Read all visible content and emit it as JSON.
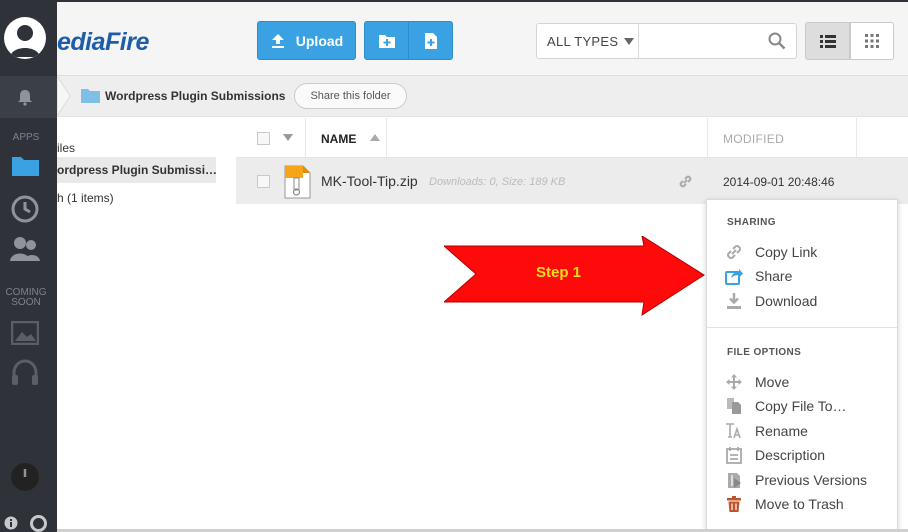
{
  "app": {
    "logo_text": "ediaFire",
    "accent": "#3aa2e2",
    "rail_bg": "#2f3339"
  },
  "rail": {
    "apps_label": "APPS",
    "coming_soon_label": "COMING SOON",
    "icons": [
      "avatar",
      "bell-icon",
      "folder-icon",
      "clock-icon",
      "contacts-icon",
      "image-icon",
      "headphones-icon",
      "power-icon",
      "info-icon",
      "help-icon"
    ]
  },
  "toolbar": {
    "upload_label": "Upload",
    "file_type_filter": "ALL TYPES",
    "search_placeholder": ""
  },
  "breadcrumb": {
    "folder_name": "Wordpress Plugin Submissions",
    "share_folder_label": "Share this folder"
  },
  "tree": {
    "files_label": "iles",
    "selected_label": "ordpress Plugin Submissi…",
    "trash_label": "h (1 items)"
  },
  "table": {
    "col_name": "NAME",
    "col_modified": "MODIFIED",
    "rows": [
      {
        "name": "MK-Tool-Tip.zip",
        "meta": "Downloads: 0, Size: 189 KB",
        "modified": "2014-09-01 20:48:46"
      }
    ]
  },
  "annotation": {
    "step_label": "Step 1",
    "arrow_color": "#ff0000"
  },
  "menu": {
    "sharing_header": "SHARING",
    "sharing_items": [
      "Copy Link",
      "Share",
      "Download"
    ],
    "options_header": "FILE OPTIONS",
    "option_items": [
      "Move",
      "Copy File To…",
      "Rename",
      "Description",
      "Previous Versions",
      "Move to Trash"
    ]
  }
}
